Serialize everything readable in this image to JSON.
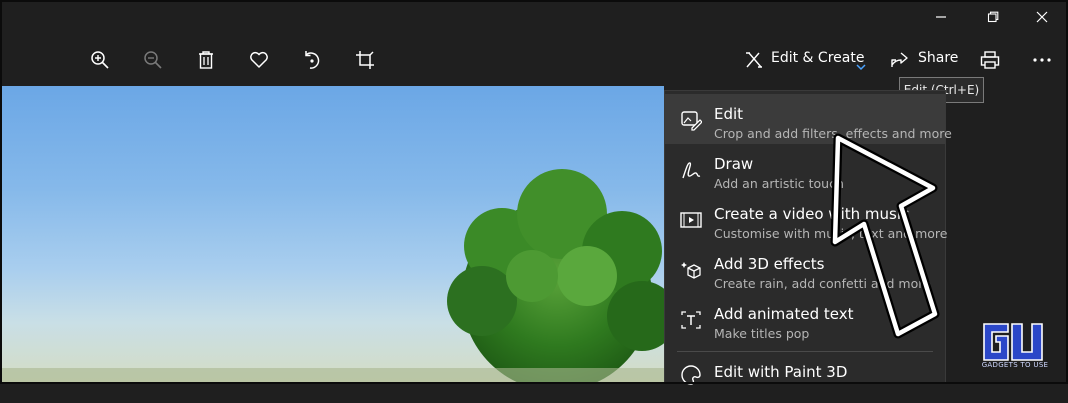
{
  "window": {
    "minimize_icon": "minimize-icon",
    "restore_icon": "restore-icon",
    "close_icon": "close-icon"
  },
  "toolbar": {
    "icons": [
      "zoom-in-icon",
      "zoom-out-icon",
      "delete-icon",
      "favorite-icon",
      "rotate-icon",
      "crop-icon"
    ],
    "edit_create_label": "Edit & Create",
    "share_label": "Share"
  },
  "tooltip": {
    "text": "Edit (Ctrl+E)"
  },
  "menu": {
    "items": [
      {
        "title": "Edit",
        "subtitle": "Crop and add filters, effects and more",
        "icon": "edit-icon"
      },
      {
        "title": "Draw",
        "subtitle": "Add an artistic touch",
        "icon": "draw-icon"
      },
      {
        "title": "Create a video with music",
        "subtitle": "Customise with music, text and more",
        "icon": "video-icon"
      },
      {
        "title": "Add 3D effects",
        "subtitle": "Create rain, add confetti and more",
        "icon": "3d-effects-icon"
      },
      {
        "title": "Add animated text",
        "subtitle": "Make titles pop",
        "icon": "animated-text-icon"
      },
      {
        "title": "Edit with Paint 3D",
        "subtitle": "",
        "icon": "paint3d-icon"
      }
    ]
  },
  "watermark": {
    "text": "GADGETS TO USE"
  },
  "colors": {
    "accent": "#4aa3ff",
    "menu_bg": "#2b2b2b",
    "toolbar_bg": "#1f1f1f"
  }
}
